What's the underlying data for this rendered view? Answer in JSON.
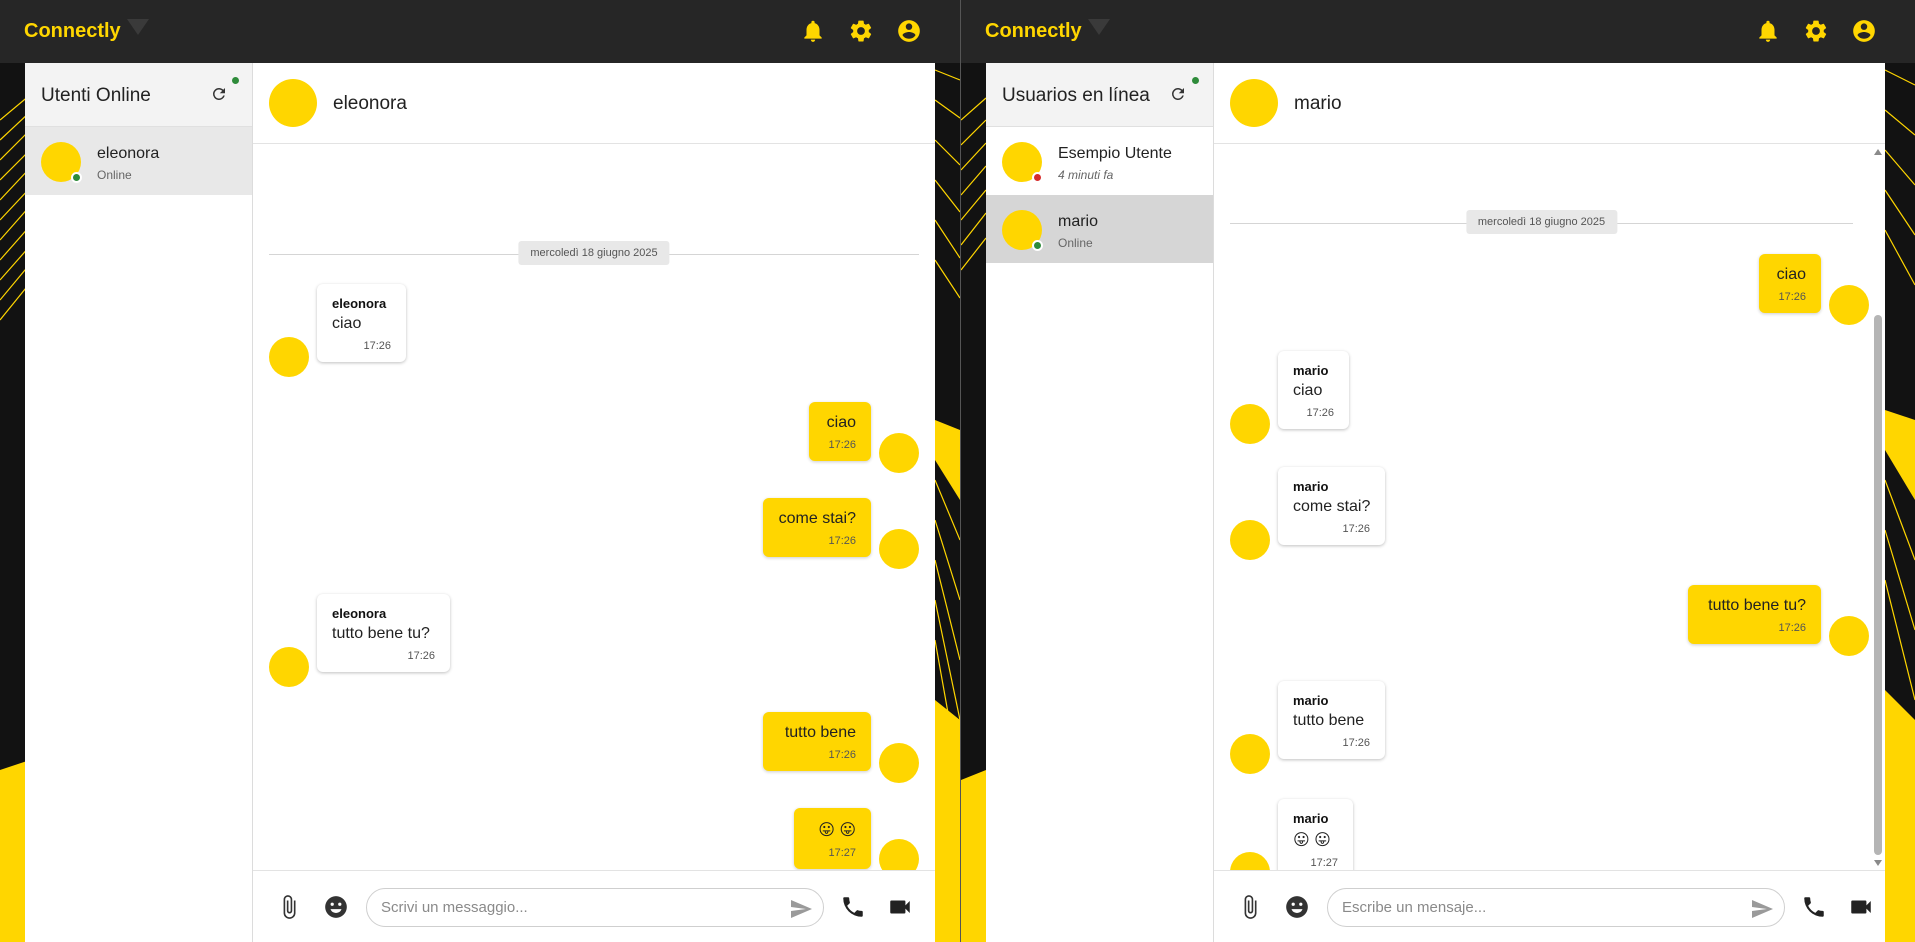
{
  "brand_color": "#ffd600",
  "windows": [
    {
      "app_name": "Connectly",
      "top_icons": [
        "bell-icon",
        "gear-icon",
        "account-circle-icon"
      ],
      "sidebar": {
        "title": "Utenti Online",
        "users": [
          {
            "name": "eleonora",
            "status_text": "Online",
            "status_color": "green",
            "selected": true
          }
        ]
      },
      "chat": {
        "contact_name": "eleonora",
        "date_label": "mercoledì 18 giugno 2025",
        "messages": [
          {
            "direction": "in",
            "sender": "eleonora",
            "text": "ciao",
            "time": "17:26"
          },
          {
            "direction": "out",
            "text": "ciao",
            "time": "17:26"
          },
          {
            "direction": "out",
            "text": "come stai?",
            "time": "17:26"
          },
          {
            "direction": "in",
            "sender": "eleonora",
            "text": "tutto bene tu?",
            "time": "17:26"
          },
          {
            "direction": "out",
            "text": "tutto bene",
            "time": "17:26"
          },
          {
            "direction": "out",
            "text": "😛 😛",
            "time": "17:27"
          }
        ],
        "input_placeholder": "Scrivi un messaggio..."
      }
    },
    {
      "app_name": "Connectly",
      "top_icons": [
        "bell-icon",
        "gear-icon",
        "account-circle-icon"
      ],
      "sidebar": {
        "title": "Usuarios en línea",
        "users": [
          {
            "name": "Esempio Utente",
            "status_text": "4 minuti fa",
            "status_color": "red",
            "selected": false
          },
          {
            "name": "mario",
            "status_text": "Online",
            "status_color": "green",
            "selected": true
          }
        ]
      },
      "chat": {
        "contact_name": "mario",
        "date_label": "mercoledì 18 giugno 2025",
        "messages": [
          {
            "direction": "out",
            "text": "ciao",
            "time": "17:26"
          },
          {
            "direction": "in",
            "sender": "mario",
            "text": "ciao",
            "time": "17:26"
          },
          {
            "direction": "in",
            "sender": "mario",
            "text": "come stai?",
            "time": "17:26"
          },
          {
            "direction": "out",
            "text": "tutto bene tu?",
            "time": "17:26"
          },
          {
            "direction": "in",
            "sender": "mario",
            "text": "tutto bene",
            "time": "17:26"
          },
          {
            "direction": "in",
            "sender": "mario",
            "text": "😛 😛",
            "time": "17:27"
          }
        ],
        "input_placeholder": "Escribe un mensaje..."
      }
    }
  ]
}
